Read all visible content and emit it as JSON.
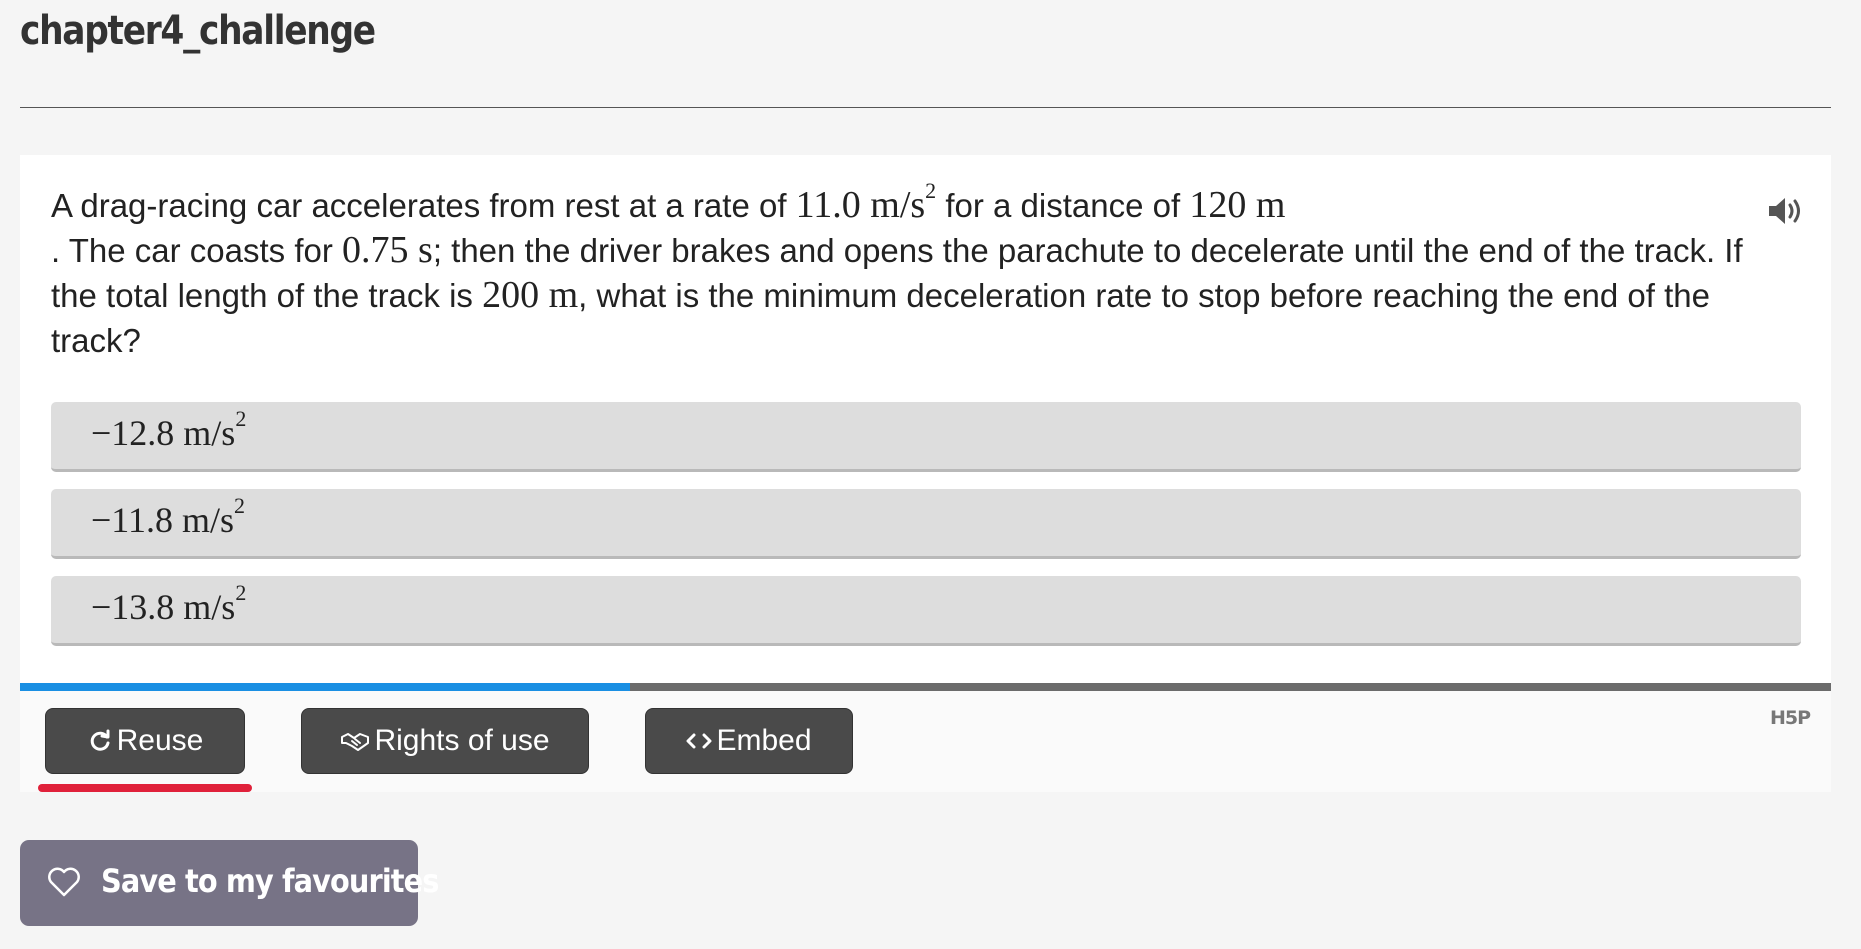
{
  "page": {
    "title": "chapter4_challenge"
  },
  "question": {
    "t1": "A drag-racing car accelerates from rest at a rate of ",
    "m1": "11.0 m/s",
    "m1_exp": "2",
    "t2": " for a distance of ",
    "m2": "120 m",
    "t3": ". The car coasts for ",
    "m3": "0.75 s",
    "t4": "; then the driver brakes and opens the parachute to decelerate until the end of the track. If the total length of the track is ",
    "m4": "200 m",
    "t5": ", what is the minimum deceleration rate to stop before reaching the end of the track?"
  },
  "answers": [
    {
      "value": "−12.8 m/s",
      "exp": "2"
    },
    {
      "value": "−11.8 m/s",
      "exp": "2"
    },
    {
      "value": "−13.8 m/s",
      "exp": "2"
    }
  ],
  "progress": {
    "fraction": 0.337,
    "fill_color": "#1a8fe3",
    "track_color": "#6b6b6b"
  },
  "footer": {
    "reuse_label": "Reuse",
    "rights_label": "Rights of use",
    "embed_label": "Embed",
    "logo_text": "H5P",
    "reuse_icon": "refresh-icon",
    "rights_icon": "handshake-icon",
    "embed_icon": "code-icon"
  },
  "favourites": {
    "label": "Save to my favourites",
    "icon": "heart-icon"
  },
  "colors": {
    "button_dark": "#4a4a4a",
    "favourite_button": "#777386",
    "active_underline": "#e0213a"
  }
}
